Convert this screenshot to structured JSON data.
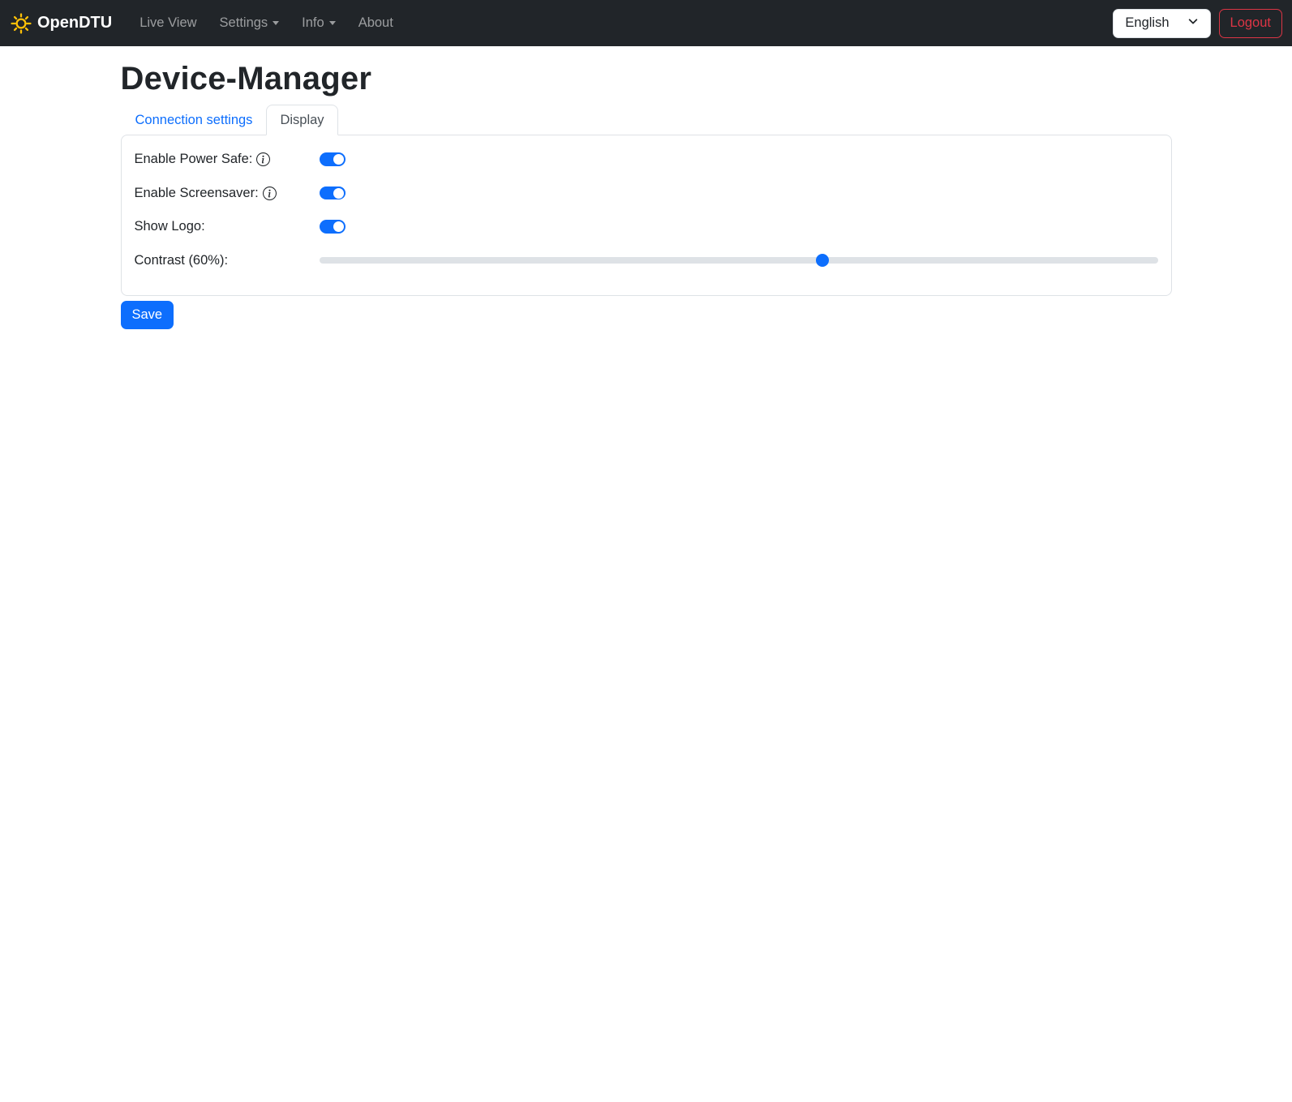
{
  "navbar": {
    "brand": "OpenDTU",
    "items": [
      {
        "label": "Live View",
        "dropdown": false
      },
      {
        "label": "Settings",
        "dropdown": true
      },
      {
        "label": "Info",
        "dropdown": true
      },
      {
        "label": "About",
        "dropdown": false
      }
    ],
    "language": {
      "selected": "English"
    },
    "logout_label": "Logout"
  },
  "page": {
    "title": "Device-Manager",
    "tabs": [
      {
        "label": "Connection settings",
        "active": false
      },
      {
        "label": "Display",
        "active": true
      }
    ]
  },
  "form": {
    "rows": [
      {
        "label": "Enable Power Safe:",
        "type": "switch",
        "has_info": true,
        "checked": true
      },
      {
        "label": "Enable Screensaver:",
        "type": "switch",
        "has_info": true,
        "checked": true
      },
      {
        "label": "Show Logo:",
        "type": "switch",
        "has_info": false,
        "checked": true
      },
      {
        "label": "Contrast (60%):",
        "type": "range",
        "value": 60,
        "min": 0,
        "max": 100,
        "thumb_style": "left: 60%"
      }
    ],
    "save_label": "Save"
  },
  "colors": {
    "navbar_bg": "#212529",
    "accent_blue": "#0d6efd",
    "logout_red": "#dc3545",
    "brand_icon_yellow": "#ffc107",
    "border_gray": "#dee2e6"
  }
}
